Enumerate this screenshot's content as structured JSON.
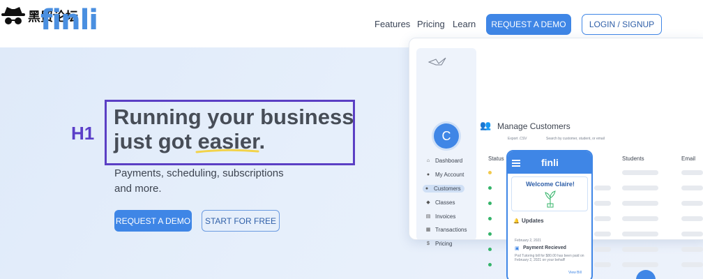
{
  "watermark": {
    "text": "黑贸论坛"
  },
  "header": {
    "logo": "finli",
    "nav": [
      "Features",
      "Pricing",
      "Learn"
    ],
    "request_demo": "REQUEST A DEMO",
    "login_signup": "LOGIN / SIGNUP"
  },
  "hero": {
    "h1_tag": "H1",
    "headline_line1": "Running your business",
    "headline_line2_a": "just got ",
    "headline_line2_b": "easier",
    "headline_line2_c": ".",
    "subtitle_line1": "Payments, scheduling, subscriptions",
    "subtitle_line2": "and more.",
    "request_demo": "REQUEST A DEMO",
    "start_free": "START FOR FREE"
  },
  "dashboard": {
    "avatar_initial": "C",
    "sidebar": [
      "Dashboard",
      "My Account",
      "Customers",
      "Classes",
      "Invoices",
      "Transactions",
      "Pricing"
    ],
    "active_item": "Customers",
    "title": "Manage Customers",
    "export_label": "Export .CSV",
    "search_placeholder": "Search by customer, student, or email",
    "columns": [
      "Status",
      "Students",
      "Email"
    ]
  },
  "phone": {
    "logo": "finli",
    "welcome": "Welcome Claire!",
    "updates_title": "Updates",
    "update_date": "February 2, 2021",
    "update_title": "Payment Recieved",
    "update_desc": "Pod Tutoring bill for $80.00 has been paid on February 2, 2021 on your behalf!",
    "view_bill": "View Bill"
  },
  "colors": {
    "accent": "#3f86e6",
    "highlight_box": "#5b3fc4",
    "status_green": "#35b46a"
  }
}
